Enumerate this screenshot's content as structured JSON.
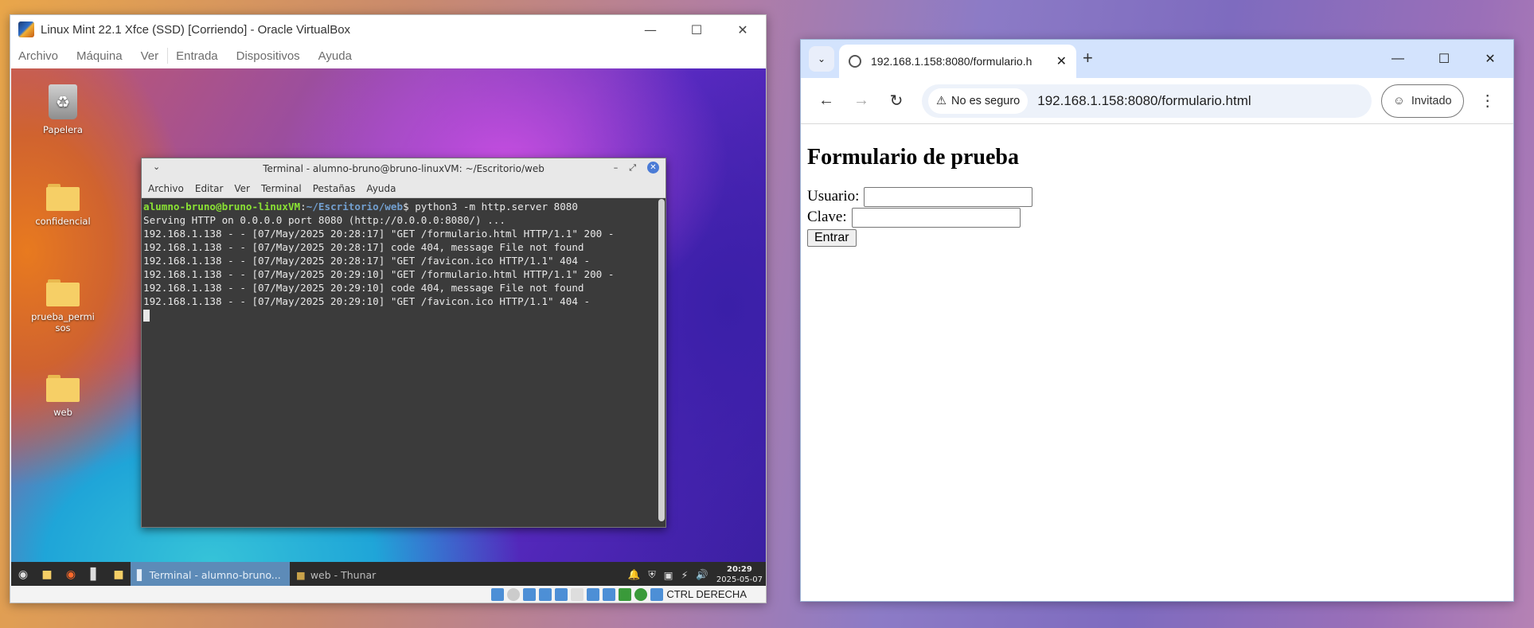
{
  "vbox": {
    "title": "Linux Mint 22.1 Xfce (SSD) [Corriendo] - Oracle VirtualBox",
    "menu": [
      "Archivo",
      "Máquina",
      "Ver",
      "Entrada",
      "Dispositivos",
      "Ayuda"
    ],
    "status_text": "CTRL DERECHA"
  },
  "desktop": {
    "icons": [
      "Papelera",
      "confidencial",
      "prueba_permisos",
      "web"
    ]
  },
  "terminal": {
    "title": "Terminal - alumno-bruno@bruno-linuxVM: ~/Escritorio/web",
    "menu": [
      "Archivo",
      "Editar",
      "Ver",
      "Terminal",
      "Pestañas",
      "Ayuda"
    ],
    "prompt_user": "alumno-bruno@bruno-linuxVM",
    "prompt_path": "~/Escritorio/web",
    "command": "$ python3 -m http.server 8080",
    "lines": [
      "Serving HTTP on 0.0.0.0 port 8080 (http://0.0.0.0:8080/) ...",
      "192.168.1.138 - - [07/May/2025 20:28:17] \"GET /formulario.html HTTP/1.1\" 200 -",
      "192.168.1.138 - - [07/May/2025 20:28:17] code 404, message File not found",
      "192.168.1.138 - - [07/May/2025 20:28:17] \"GET /favicon.ico HTTP/1.1\" 404 -",
      "192.168.1.138 - - [07/May/2025 20:29:10] \"GET /formulario.html HTTP/1.1\" 200 -",
      "192.168.1.138 - - [07/May/2025 20:29:10] code 404, message File not found",
      "192.168.1.138 - - [07/May/2025 20:29:10] \"GET /favicon.ico HTTP/1.1\" 404 -"
    ]
  },
  "taskbar": {
    "task_terminal": "Terminal - alumno-bruno...",
    "task_thunar": "web - Thunar",
    "time": "20:29",
    "date": "2025-05-07"
  },
  "browser": {
    "tab_title": "192.168.1.158:8080/formulario.h",
    "security": "No es seguro",
    "url": "192.168.1.158:8080/formulario.html",
    "profile": "Invitado",
    "page": {
      "heading": "Formulario de prueba",
      "user_label": "Usuario:",
      "pass_label": "Clave:",
      "submit": "Entrar"
    }
  }
}
